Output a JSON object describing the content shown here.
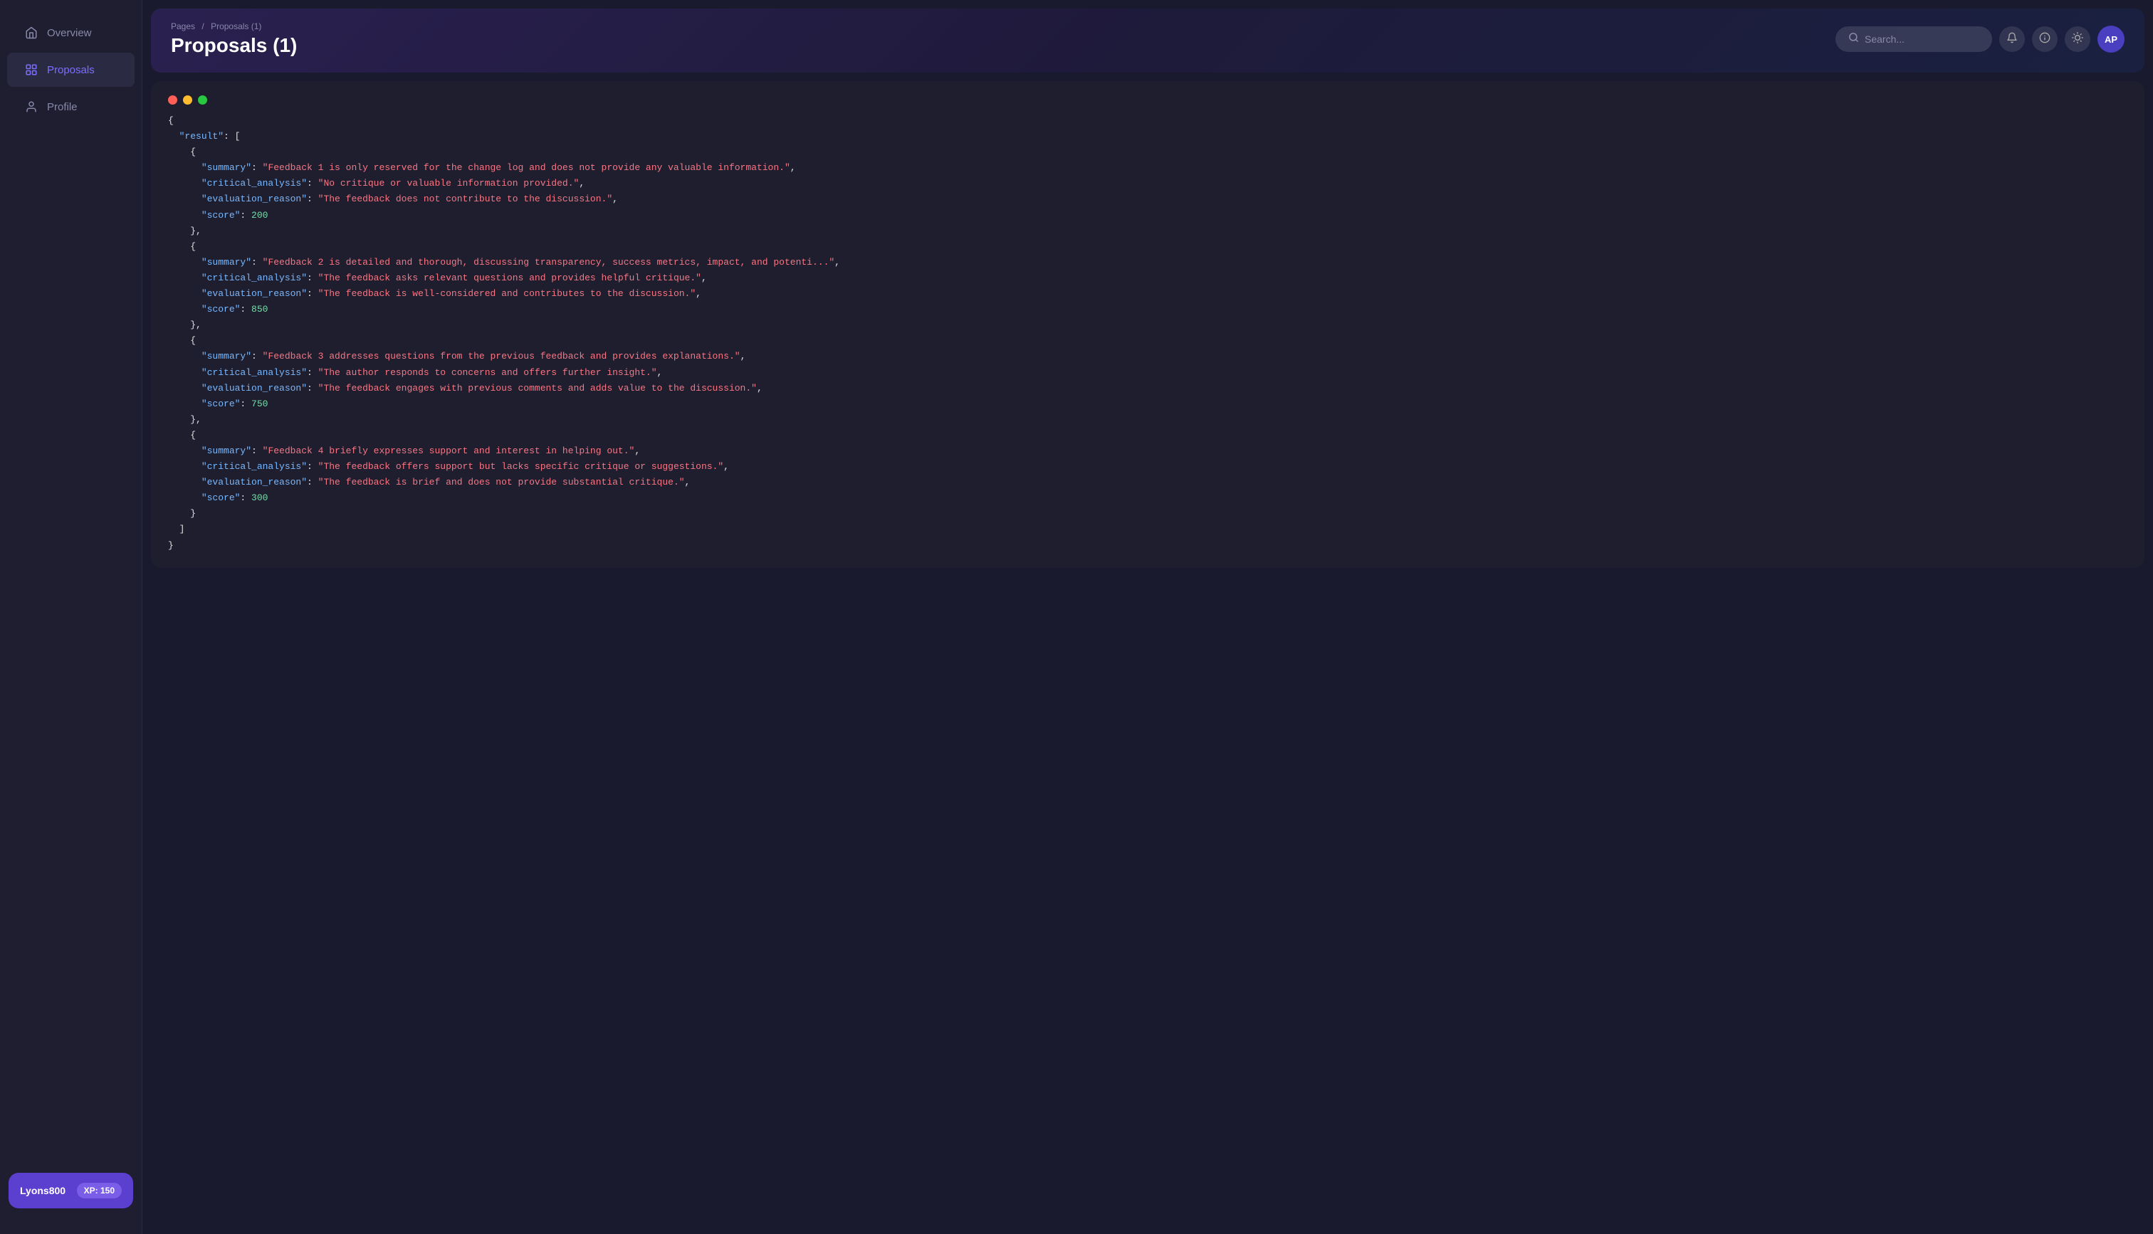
{
  "sidebar": {
    "items": [
      {
        "id": "overview",
        "label": "Overview",
        "icon": "home-icon",
        "active": false
      },
      {
        "id": "proposals",
        "label": "Proposals",
        "icon": "proposals-icon",
        "active": true
      },
      {
        "id": "profile",
        "label": "Profile",
        "icon": "profile-icon",
        "active": false
      }
    ]
  },
  "user": {
    "name": "Lyons800",
    "xp_label": "XP: 150"
  },
  "header": {
    "breadcrumb_root": "Pages",
    "breadcrumb_separator": "/",
    "breadcrumb_current": "Proposals (1)",
    "title": "Proposals (1)"
  },
  "search": {
    "placeholder": "Search..."
  },
  "avatar": {
    "initials": "AP"
  },
  "code": {
    "result": [
      {
        "summary": "Feedback 1 is only reserved for the change log and does not provide any valuable information.",
        "critical_analysis": "No critique or valuable information provided.",
        "evaluation_reason": "The feedback does not contribute to the discussion.",
        "score": 200
      },
      {
        "summary": "Feedback 2 is detailed and thorough, discussing transparency, success metrics, impact, and potenti...",
        "critical_analysis": "The feedback asks relevant questions and provides helpful critique.",
        "evaluation_reason": "The feedback is well-considered and contributes to the discussion.",
        "score": 850
      },
      {
        "summary": "Feedback 3 addresses questions from the previous feedback and provides explanations.",
        "critical_analysis": "The author responds to concerns and offers further insight.",
        "evaluation_reason": "The feedback engages with previous comments and adds value to the discussion.",
        "score": 750
      },
      {
        "summary": "Feedback 4 briefly expresses support and interest in helping out.",
        "critical_analysis": "The feedback offers support but lacks specific critique or suggestions.",
        "evaluation_reason": "The feedback is brief and does not provide substantial critique.",
        "score": 300
      }
    ]
  }
}
